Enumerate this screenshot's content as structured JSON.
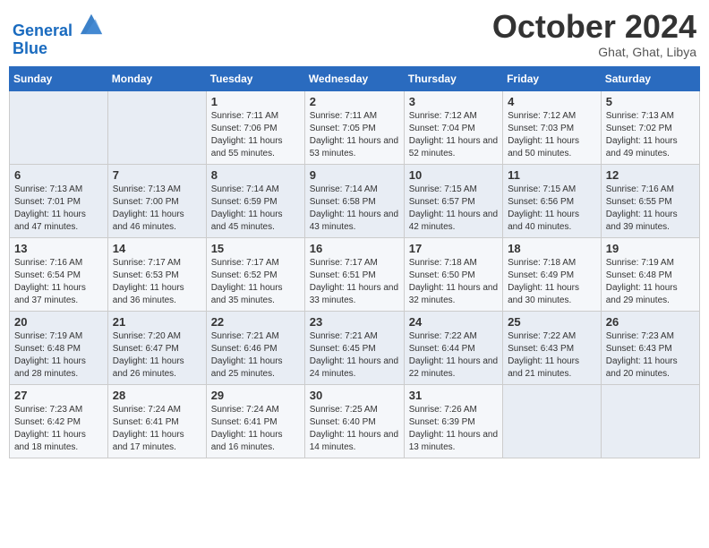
{
  "header": {
    "logo_line1": "General",
    "logo_line2": "Blue",
    "month": "October 2024",
    "location": "Ghat, Ghat, Libya"
  },
  "columns": [
    "Sunday",
    "Monday",
    "Tuesday",
    "Wednesday",
    "Thursday",
    "Friday",
    "Saturday"
  ],
  "weeks": [
    [
      {
        "day": "",
        "info": ""
      },
      {
        "day": "",
        "info": ""
      },
      {
        "day": "1",
        "info": "Sunrise: 7:11 AM\nSunset: 7:06 PM\nDaylight: 11 hours and 55 minutes."
      },
      {
        "day": "2",
        "info": "Sunrise: 7:11 AM\nSunset: 7:05 PM\nDaylight: 11 hours and 53 minutes."
      },
      {
        "day": "3",
        "info": "Sunrise: 7:12 AM\nSunset: 7:04 PM\nDaylight: 11 hours and 52 minutes."
      },
      {
        "day": "4",
        "info": "Sunrise: 7:12 AM\nSunset: 7:03 PM\nDaylight: 11 hours and 50 minutes."
      },
      {
        "day": "5",
        "info": "Sunrise: 7:13 AM\nSunset: 7:02 PM\nDaylight: 11 hours and 49 minutes."
      }
    ],
    [
      {
        "day": "6",
        "info": "Sunrise: 7:13 AM\nSunset: 7:01 PM\nDaylight: 11 hours and 47 minutes."
      },
      {
        "day": "7",
        "info": "Sunrise: 7:13 AM\nSunset: 7:00 PM\nDaylight: 11 hours and 46 minutes."
      },
      {
        "day": "8",
        "info": "Sunrise: 7:14 AM\nSunset: 6:59 PM\nDaylight: 11 hours and 45 minutes."
      },
      {
        "day": "9",
        "info": "Sunrise: 7:14 AM\nSunset: 6:58 PM\nDaylight: 11 hours and 43 minutes."
      },
      {
        "day": "10",
        "info": "Sunrise: 7:15 AM\nSunset: 6:57 PM\nDaylight: 11 hours and 42 minutes."
      },
      {
        "day": "11",
        "info": "Sunrise: 7:15 AM\nSunset: 6:56 PM\nDaylight: 11 hours and 40 minutes."
      },
      {
        "day": "12",
        "info": "Sunrise: 7:16 AM\nSunset: 6:55 PM\nDaylight: 11 hours and 39 minutes."
      }
    ],
    [
      {
        "day": "13",
        "info": "Sunrise: 7:16 AM\nSunset: 6:54 PM\nDaylight: 11 hours and 37 minutes."
      },
      {
        "day": "14",
        "info": "Sunrise: 7:17 AM\nSunset: 6:53 PM\nDaylight: 11 hours and 36 minutes."
      },
      {
        "day": "15",
        "info": "Sunrise: 7:17 AM\nSunset: 6:52 PM\nDaylight: 11 hours and 35 minutes."
      },
      {
        "day": "16",
        "info": "Sunrise: 7:17 AM\nSunset: 6:51 PM\nDaylight: 11 hours and 33 minutes."
      },
      {
        "day": "17",
        "info": "Sunrise: 7:18 AM\nSunset: 6:50 PM\nDaylight: 11 hours and 32 minutes."
      },
      {
        "day": "18",
        "info": "Sunrise: 7:18 AM\nSunset: 6:49 PM\nDaylight: 11 hours and 30 minutes."
      },
      {
        "day": "19",
        "info": "Sunrise: 7:19 AM\nSunset: 6:48 PM\nDaylight: 11 hours and 29 minutes."
      }
    ],
    [
      {
        "day": "20",
        "info": "Sunrise: 7:19 AM\nSunset: 6:48 PM\nDaylight: 11 hours and 28 minutes."
      },
      {
        "day": "21",
        "info": "Sunrise: 7:20 AM\nSunset: 6:47 PM\nDaylight: 11 hours and 26 minutes."
      },
      {
        "day": "22",
        "info": "Sunrise: 7:21 AM\nSunset: 6:46 PM\nDaylight: 11 hours and 25 minutes."
      },
      {
        "day": "23",
        "info": "Sunrise: 7:21 AM\nSunset: 6:45 PM\nDaylight: 11 hours and 24 minutes."
      },
      {
        "day": "24",
        "info": "Sunrise: 7:22 AM\nSunset: 6:44 PM\nDaylight: 11 hours and 22 minutes."
      },
      {
        "day": "25",
        "info": "Sunrise: 7:22 AM\nSunset: 6:43 PM\nDaylight: 11 hours and 21 minutes."
      },
      {
        "day": "26",
        "info": "Sunrise: 7:23 AM\nSunset: 6:43 PM\nDaylight: 11 hours and 20 minutes."
      }
    ],
    [
      {
        "day": "27",
        "info": "Sunrise: 7:23 AM\nSunset: 6:42 PM\nDaylight: 11 hours and 18 minutes."
      },
      {
        "day": "28",
        "info": "Sunrise: 7:24 AM\nSunset: 6:41 PM\nDaylight: 11 hours and 17 minutes."
      },
      {
        "day": "29",
        "info": "Sunrise: 7:24 AM\nSunset: 6:41 PM\nDaylight: 11 hours and 16 minutes."
      },
      {
        "day": "30",
        "info": "Sunrise: 7:25 AM\nSunset: 6:40 PM\nDaylight: 11 hours and 14 minutes."
      },
      {
        "day": "31",
        "info": "Sunrise: 7:26 AM\nSunset: 6:39 PM\nDaylight: 11 hours and 13 minutes."
      },
      {
        "day": "",
        "info": ""
      },
      {
        "day": "",
        "info": ""
      }
    ]
  ]
}
